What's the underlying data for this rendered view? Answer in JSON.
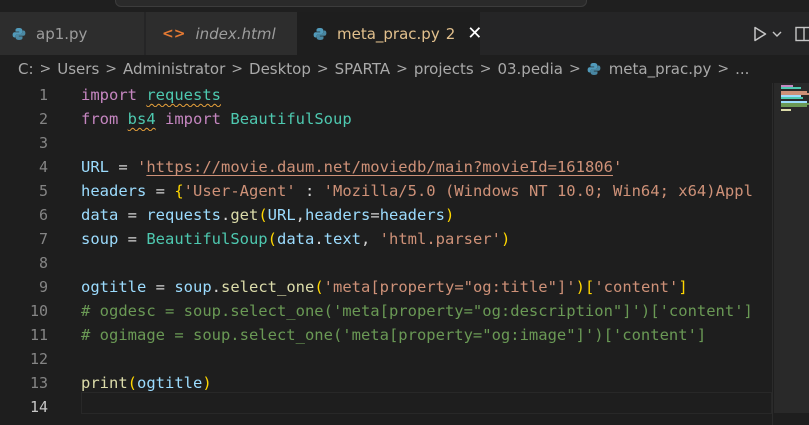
{
  "tabs": [
    {
      "label": "ap1.py",
      "icon": "python-icon"
    },
    {
      "label": "index.html",
      "icon": "html-icon"
    },
    {
      "label": "meta_prac.py",
      "icon": "python-icon",
      "badge": "2",
      "active": true
    }
  ],
  "breadcrumb": [
    "C:",
    "Users",
    "Administrator",
    "Desktop",
    "SPARTA",
    "projects",
    "03.pedia",
    "meta_prac.py",
    "..."
  ],
  "editor": {
    "line_numbers": [
      "1",
      "2",
      "3",
      "4",
      "5",
      "6",
      "7",
      "8",
      "9",
      "10",
      "11",
      "12",
      "13",
      "14"
    ],
    "active_line": "14",
    "code": {
      "l1": {
        "kw": "import",
        "mod": "requests"
      },
      "l2": {
        "kw1": "from",
        "mod": "bs4",
        "kw2": "import",
        "cls": "BeautifulSoup"
      },
      "l4": {
        "var": "URL",
        "op": " = ",
        "q1": "'",
        "url": "https://movie.daum.net/moviedb/main?movieId=161806",
        "q2": "'"
      },
      "l5": {
        "var": "headers",
        "op": " = ",
        "brace": "{",
        "key": "'User-Agent'",
        "colon": " : ",
        "val": "'Mozilla/5.0 (Windows NT 10.0; Win64; x64)Appl"
      },
      "l6": {
        "var": "data",
        "op": " = ",
        "obj": "requests",
        "dot": ".",
        "fn": "get",
        "po": "(",
        "a1": "URL",
        "comma": ",",
        "a2k": "headers",
        "eq": "=",
        "a2v": "headers",
        "pc": ")"
      },
      "l7": {
        "var": "soup",
        "op": " = ",
        "cls": "BeautifulSoup",
        "po": "(",
        "a1": "data",
        "dot": ".",
        "a1b": "text",
        "comma": ", ",
        "s": "'html.parser'",
        "pc": ")"
      },
      "l9": {
        "var": "ogtitle",
        "op": " = ",
        "obj": "soup",
        "dot": ".",
        "fn": "select_one",
        "po": "(",
        "s": "'meta[property=\"og:title\"]'",
        "pc": ")",
        "bo": "[",
        "k": "'content'",
        "bc": "]"
      },
      "l10": "# ogdesc = soup.select_one('meta[property=\"og:description\"]')['content']",
      "l11": "# ogimage = soup.select_one('meta[property=\"og:image\"]')['content']",
      "l13": {
        "fn": "print",
        "po": "(",
        "a": "ogtitle",
        "pc": ")"
      }
    }
  },
  "colors": {
    "background": "#1e1e1e",
    "keyword": "#c586c0",
    "class": "#4ec9b0",
    "variable": "#9cdcfe",
    "function": "#dcdcaa",
    "string": "#ce9178",
    "comment": "#6a9955",
    "bracket_gold": "#ffd700",
    "bracket_orchid": "#da70d6",
    "modified_tab": "#e2c08d"
  },
  "icons": {
    "run": "play-icon",
    "run_menu": "chevron-down-icon",
    "split": "split-editor-icon",
    "close": "close-icon"
  }
}
